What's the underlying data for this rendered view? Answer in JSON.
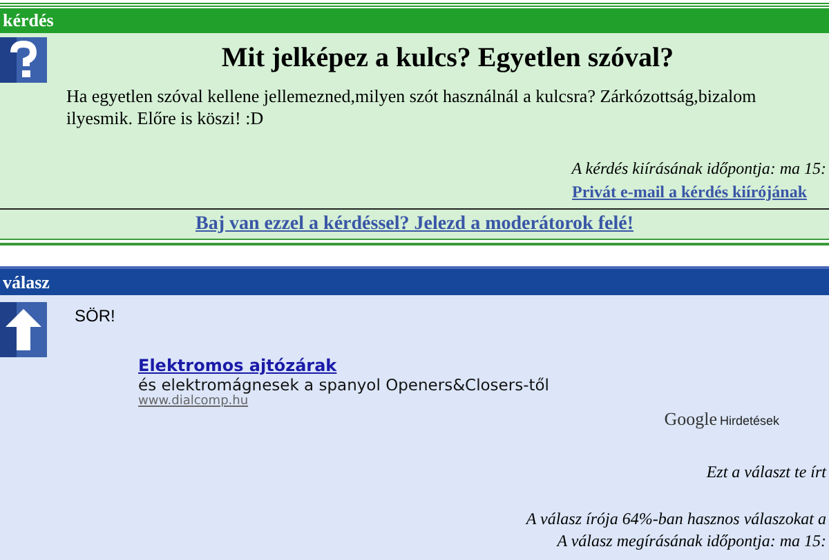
{
  "question": {
    "header": "kérdés",
    "title": "Mit jelképez a kulcs? Egyetlen szóval?",
    "body": "Ha egyetlen szóval kellene jellemezned,milyen szót használnál a kulcsra? Zárkózottság,bizalom ilyesmik. Előre is köszi! :D",
    "posted": "A kérdés kiírásának időpontja: ma 15:",
    "private_mail_link": "Privát e-mail a kérdés kiírójának",
    "report_link": "Baj van ezzel a kérdéssel? Jelezd a moderátorok felé!"
  },
  "answer": {
    "header": "válasz",
    "text": "SÖR!",
    "ad": {
      "title": "Elektromos ajtózárak",
      "description": "és elektromágnesek a spanyol Openers&Closers-től",
      "url": "www.dialcomp.hu",
      "brand": "Google",
      "brand_label": "Hirdetések"
    },
    "own_note": "Ezt a választ te írt",
    "usefulness": "A válasz írója 64%-ban hasznos válaszokat a",
    "posted": "A válasz megírásának időpontja: ma 15:"
  }
}
